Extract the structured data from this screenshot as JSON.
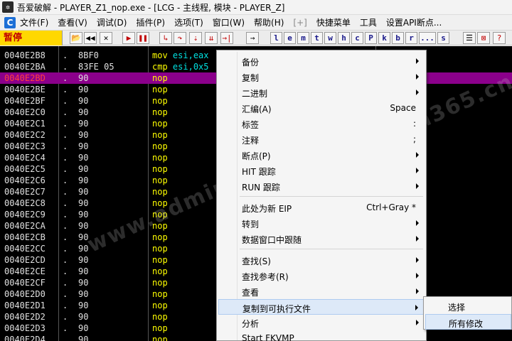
{
  "titlebar": {
    "icon": "bug-app-icon",
    "title": "吾爱破解 - PLAYER_Z1_nop.exe - [LCG - 主线程, 模块 - PLAYER_Z]"
  },
  "menubar": {
    "items": [
      "文件(F)",
      "查看(V)",
      "调试(D)",
      "插件(P)",
      "选项(T)",
      "窗口(W)",
      "帮助(H)",
      "[+]",
      "快捷菜单",
      "工具",
      "设置API断点..."
    ]
  },
  "toolbar": {
    "status": "暂停",
    "letters": [
      "l",
      "e",
      "m",
      "t",
      "w",
      "h",
      "c",
      "P",
      "k",
      "b",
      "r",
      "...",
      "s"
    ]
  },
  "disasm": {
    "rows": [
      {
        "addr": "0040E2B8",
        "bp": ".",
        "hex": "8BF0",
        "op": "mov",
        "args": "esi,eax"
      },
      {
        "addr": "0040E2BA",
        "bp": ".",
        "hex": "83FE 05",
        "op": "cmp",
        "args": "esi,0x5"
      },
      {
        "addr": "0040E2BD",
        "bp": ".",
        "hex": "90",
        "op": "nop",
        "args": ""
      },
      {
        "addr": "0040E2BE",
        "bp": ".",
        "hex": "90",
        "op": "nop",
        "args": ""
      },
      {
        "addr": "0040E2BF",
        "bp": ".",
        "hex": "90",
        "op": "nop",
        "args": ""
      },
      {
        "addr": "0040E2C0",
        "bp": ".",
        "hex": "90",
        "op": "nop",
        "args": ""
      },
      {
        "addr": "0040E2C1",
        "bp": ".",
        "hex": "90",
        "op": "nop",
        "args": ""
      },
      {
        "addr": "0040E2C2",
        "bp": ".",
        "hex": "90",
        "op": "nop",
        "args": ""
      },
      {
        "addr": "0040E2C3",
        "bp": ".",
        "hex": "90",
        "op": "nop",
        "args": ""
      },
      {
        "addr": "0040E2C4",
        "bp": ".",
        "hex": "90",
        "op": "nop",
        "args": ""
      },
      {
        "addr": "0040E2C5",
        "bp": ".",
        "hex": "90",
        "op": "nop",
        "args": ""
      },
      {
        "addr": "0040E2C6",
        "bp": ".",
        "hex": "90",
        "op": "nop",
        "args": ""
      },
      {
        "addr": "0040E2C7",
        "bp": ".",
        "hex": "90",
        "op": "nop",
        "args": ""
      },
      {
        "addr": "0040E2C8",
        "bp": ".",
        "hex": "90",
        "op": "nop",
        "args": ""
      },
      {
        "addr": "0040E2C9",
        "bp": ".",
        "hex": "90",
        "op": "nop",
        "args": ""
      },
      {
        "addr": "0040E2CA",
        "bp": ".",
        "hex": "90",
        "op": "nop",
        "args": ""
      },
      {
        "addr": "0040E2CB",
        "bp": ".",
        "hex": "90",
        "op": "nop",
        "args": ""
      },
      {
        "addr": "0040E2CC",
        "bp": ".",
        "hex": "90",
        "op": "nop",
        "args": ""
      },
      {
        "addr": "0040E2CD",
        "bp": ".",
        "hex": "90",
        "op": "nop",
        "args": ""
      },
      {
        "addr": "0040E2CE",
        "bp": ".",
        "hex": "90",
        "op": "nop",
        "args": ""
      },
      {
        "addr": "0040E2CF",
        "bp": ".",
        "hex": "90",
        "op": "nop",
        "args": ""
      },
      {
        "addr": "0040E2D0",
        "bp": ".",
        "hex": "90",
        "op": "nop",
        "args": ""
      },
      {
        "addr": "0040E2D1",
        "bp": ".",
        "hex": "90",
        "op": "nop",
        "args": ""
      },
      {
        "addr": "0040E2D2",
        "bp": ".",
        "hex": "90",
        "op": "nop",
        "args": ""
      },
      {
        "addr": "0040E2D3",
        "bp": ".",
        "hex": "90",
        "op": "nop",
        "args": ""
      },
      {
        "addr": "0040E2D4",
        "bp": ".",
        "hex": "90",
        "op": "nop",
        "args": ""
      }
    ],
    "selected_addr": "0040E2BD"
  },
  "watermark": "www.admin365.cn",
  "context_menu": {
    "items": [
      {
        "label": "备份",
        "shortcut": "",
        "submenu": true
      },
      {
        "label": "复制",
        "shortcut": "",
        "submenu": true
      },
      {
        "label": "二进制",
        "shortcut": "",
        "submenu": true
      },
      {
        "label": "汇编(A)",
        "shortcut": "Space",
        "submenu": false
      },
      {
        "label": "标签",
        "shortcut": ":",
        "submenu": false
      },
      {
        "label": "注释",
        "shortcut": ";",
        "submenu": false
      },
      {
        "label": "断点(P)",
        "shortcut": "",
        "submenu": true
      },
      {
        "label": "HIT 跟踪",
        "shortcut": "",
        "submenu": true
      },
      {
        "label": "RUN 跟踪",
        "shortcut": "",
        "submenu": true
      },
      {
        "label": "此处为新 EIP",
        "shortcut": "Ctrl+Gray *",
        "submenu": false
      },
      {
        "label": "转到",
        "shortcut": "",
        "submenu": true
      },
      {
        "label": "数据窗口中跟随",
        "shortcut": "",
        "submenu": true
      },
      {
        "label": "查找(S)",
        "shortcut": "",
        "submenu": true
      },
      {
        "label": "查找参考(R)",
        "shortcut": "",
        "submenu": true
      },
      {
        "label": "查看",
        "shortcut": "",
        "submenu": true
      },
      {
        "label": "复制到可执行文件",
        "shortcut": "",
        "submenu": true
      },
      {
        "label": "分析",
        "shortcut": "",
        "submenu": true
      },
      {
        "label": "Start FKVMP",
        "shortcut": "",
        "submenu": false
      }
    ],
    "highlighted": "复制到可执行文件"
  },
  "submenu": {
    "items": [
      "选择",
      "所有修改"
    ],
    "highlighted": "所有修改"
  },
  "colors": {
    "selected_row": "#8b008b",
    "pause_bg": "#ffd800",
    "pause_fg": "#c00000",
    "mnemonic": "#ffff00",
    "register": "#00e0e0"
  }
}
